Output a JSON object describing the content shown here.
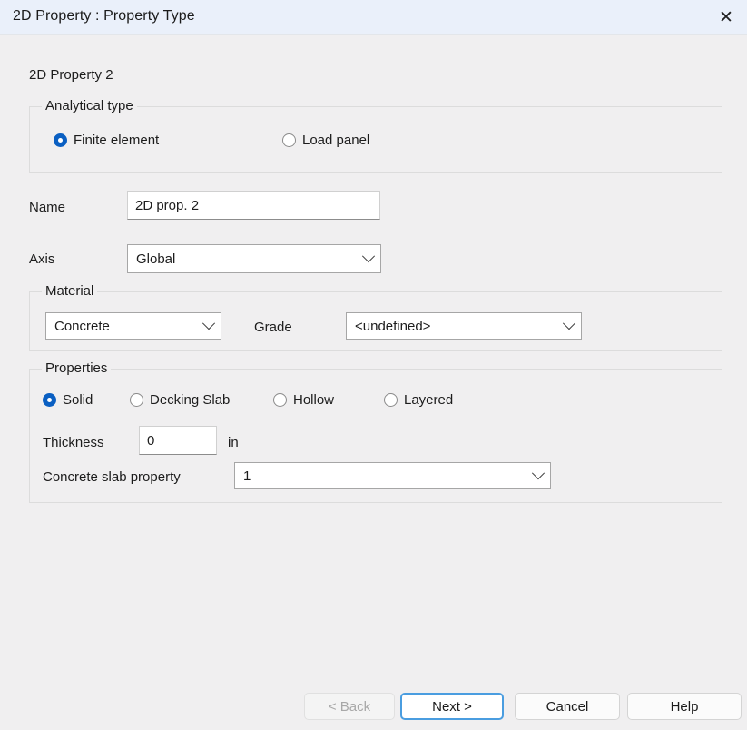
{
  "window": {
    "title": "2D Property : Property Type",
    "close_icon": "close-icon",
    "close_glyph": "✕"
  },
  "page": {
    "title": "2D Property 2"
  },
  "analytical_type": {
    "legend": "Analytical type",
    "options": [
      {
        "label": "Finite element",
        "selected": true
      },
      {
        "label": "Load panel",
        "selected": false
      }
    ]
  },
  "name_field": {
    "label": "Name",
    "value": "2D prop. 2",
    "placeholder": ""
  },
  "axis_field": {
    "label": "Axis",
    "value": "Global"
  },
  "material": {
    "legend": "Material",
    "type_value": "Concrete",
    "grade_label": "Grade",
    "grade_value": "<undefined>"
  },
  "properties": {
    "legend": "Properties",
    "options": [
      {
        "label": "Solid",
        "selected": true
      },
      {
        "label": "Decking Slab",
        "selected": false
      },
      {
        "label": "Hollow",
        "selected": false
      },
      {
        "label": "Layered",
        "selected": false
      }
    ],
    "thickness_label": "Thickness",
    "thickness_value": "0",
    "thickness_unit": "in",
    "slab_property_label": "Concrete slab property",
    "slab_property_value": "1"
  },
  "footer": {
    "back_label": "< Back",
    "next_label": "Next >",
    "cancel_label": "Cancel",
    "help_label": "Help"
  },
  "colors": {
    "titlebar": "#eaf0fa",
    "background": "#f0eff0",
    "accent": "#0a5fc2",
    "focus_border": "#4a9de0"
  }
}
